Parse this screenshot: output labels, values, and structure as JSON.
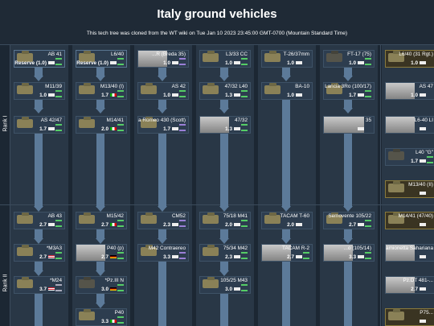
{
  "page": {
    "title": "Italy ground vehicles",
    "subtitle": "This tech tree was cloned from the WT wiki on Tue Jan 10 2023 23:45:00 GMT-0700 (Mountain Standard Time)"
  },
  "ranks": [
    {
      "label": "Rank I"
    },
    {
      "label": "Rank II"
    }
  ],
  "vehicles": [
    {
      "id": "ab41",
      "name": "AB 41",
      "br": "Reserve (1.0)",
      "flag": "wh",
      "role": "green"
    },
    {
      "id": "l640",
      "name": "L6/40",
      "br": "Reserve (1.0)",
      "flag": "wh",
      "role": "green"
    },
    {
      "id": "breda",
      "name": "...R (Breda 35)",
      "br": "1.0",
      "flag": "wh",
      "role": "purple"
    },
    {
      "id": "l333cc",
      "name": "L3/33 CC",
      "br": "1.0",
      "flag": "wh",
      "role": "green"
    },
    {
      "id": "t26",
      "name": "T-26/37mm",
      "br": "1.0",
      "flag": "wh",
      "role": ""
    },
    {
      "id": "ft17",
      "name": "FT-17 (75)",
      "br": "1.0",
      "flag": "wh",
      "role": "green"
    },
    {
      "id": "l640rgt",
      "name": "L6/40 (31 Rgt.)",
      "br": "1.0",
      "flag": "wh",
      "role": ""
    },
    {
      "id": "m1139",
      "name": "M11/39",
      "br": "1.0",
      "flag": "wh",
      "role": "green"
    },
    {
      "id": "m1340i",
      "name": "M13/40 (I)",
      "br": "1.7",
      "flag": "it",
      "role": "green"
    },
    {
      "id": "as42",
      "name": "AS 42",
      "br": "1.0",
      "flag": "wh",
      "role": "green"
    },
    {
      "id": "l347l40",
      "name": "47/32 L40",
      "br": "1.3",
      "flag": "wh",
      "role": "green"
    },
    {
      "id": "ba10",
      "name": "BA-10",
      "br": "1.0",
      "flag": "wh",
      "role": ""
    },
    {
      "id": "lancia",
      "name": "Lancia 3Ro (100/17)",
      "br": "1.7",
      "flag": "wh",
      "role": "green"
    },
    {
      "id": "as47",
      "name": "AS 47",
      "br": "1.0",
      "flag": "wh",
      "role": ""
    },
    {
      "id": "as4247",
      "name": "AS 42/47",
      "br": "1.7",
      "flag": "wh",
      "role": "green"
    },
    {
      "id": "m1441",
      "name": "M14/41",
      "br": "2.0",
      "flag": "it",
      "role": "green"
    },
    {
      "id": "alfa",
      "name": "Alfa Romeo 430 (Scott)",
      "br": "1.7",
      "flag": "wh",
      "role": "purple"
    },
    {
      "id": "s4732",
      "name": "47/32",
      "br": "1.3",
      "flag": "wh",
      "role": "green"
    },
    {
      "id": "s35",
      "name": "35",
      "br": "",
      "flag": "wh",
      "role": ""
    },
    {
      "id": "l640li",
      "name": "L6-40 LI",
      "br": "",
      "flag": "wh",
      "role": ""
    },
    {
      "id": "l40g",
      "name": "L40 \"G\"",
      "br": "1.7",
      "flag": "wh",
      "role": "green"
    },
    {
      "id": "m1340ii",
      "name": "M13/40 (II)",
      "br": "",
      "flag": "wh",
      "role": ""
    },
    {
      "id": "ab43",
      "name": "AB 43",
      "br": "2.7",
      "flag": "wh",
      "role": "green"
    },
    {
      "id": "m1542",
      "name": "M15/42",
      "br": "2.7",
      "flag": "it",
      "role": "green"
    },
    {
      "id": "cm52",
      "name": "CM52",
      "br": "2.3",
      "flag": "wh",
      "role": "purple"
    },
    {
      "id": "s7518m41",
      "name": "75/18 M41",
      "br": "2.0",
      "flag": "wh",
      "role": "green"
    },
    {
      "id": "tacamt60",
      "name": "TACAM T-60",
      "br": "2.0",
      "flag": "wh",
      "role": ""
    },
    {
      "id": "semovente10522",
      "name": "Semovente 105/22",
      "br": "2.7",
      "flag": "wh",
      "role": "green"
    },
    {
      "id": "m1441_47",
      "name": "M14/41 (47/40)",
      "br": "",
      "flag": "wh",
      "role": ""
    },
    {
      "id": "m3a3",
      "name": "*M3A3",
      "br": "2.7",
      "flag": "us",
      "role": "green"
    },
    {
      "id": "p40p",
      "name": "P40 (p)",
      "br": "2.7",
      "flag": "de",
      "role": "green"
    },
    {
      "id": "m42contr",
      "name": "M42 Contraereo",
      "br": "3.3",
      "flag": "wh",
      "role": "purple"
    },
    {
      "id": "s7534m42",
      "name": "75/34 M42",
      "br": "2.3",
      "flag": "wh",
      "role": "green"
    },
    {
      "id": "tacamr2",
      "name": "TACAM R-2",
      "br": "2.7",
      "flag": "wh",
      "role": "green"
    },
    {
      "id": "s10514",
      "name": "...o (105/14)",
      "br": "3.3",
      "flag": "wh",
      "role": "green"
    },
    {
      "id": "camionetta",
      "name": "Camionetta Sahariana",
      "br": "",
      "flag": "wh",
      "role": ""
    },
    {
      "id": "m24",
      "name": "*M24",
      "br": "3.7",
      "flag": "us",
      "role": "gray"
    },
    {
      "id": "pz3n",
      "name": "*Pz.III N",
      "br": "3.0",
      "flag": "de",
      "role": "green"
    },
    {
      "id": "s10525m43",
      "name": "105/25 M43",
      "br": "3.0",
      "flag": "wh",
      "role": "green"
    },
    {
      "id": "pzdt",
      "name": "Pz.DT 481-...",
      "br": "2.7",
      "flag": "wh",
      "role": ""
    },
    {
      "id": "p40",
      "name": "P40",
      "br": "3.3",
      "flag": "it",
      "role": "green"
    },
    {
      "id": "p75",
      "name": "P75...",
      "br": "",
      "flag": "wh",
      "role": ""
    }
  ]
}
